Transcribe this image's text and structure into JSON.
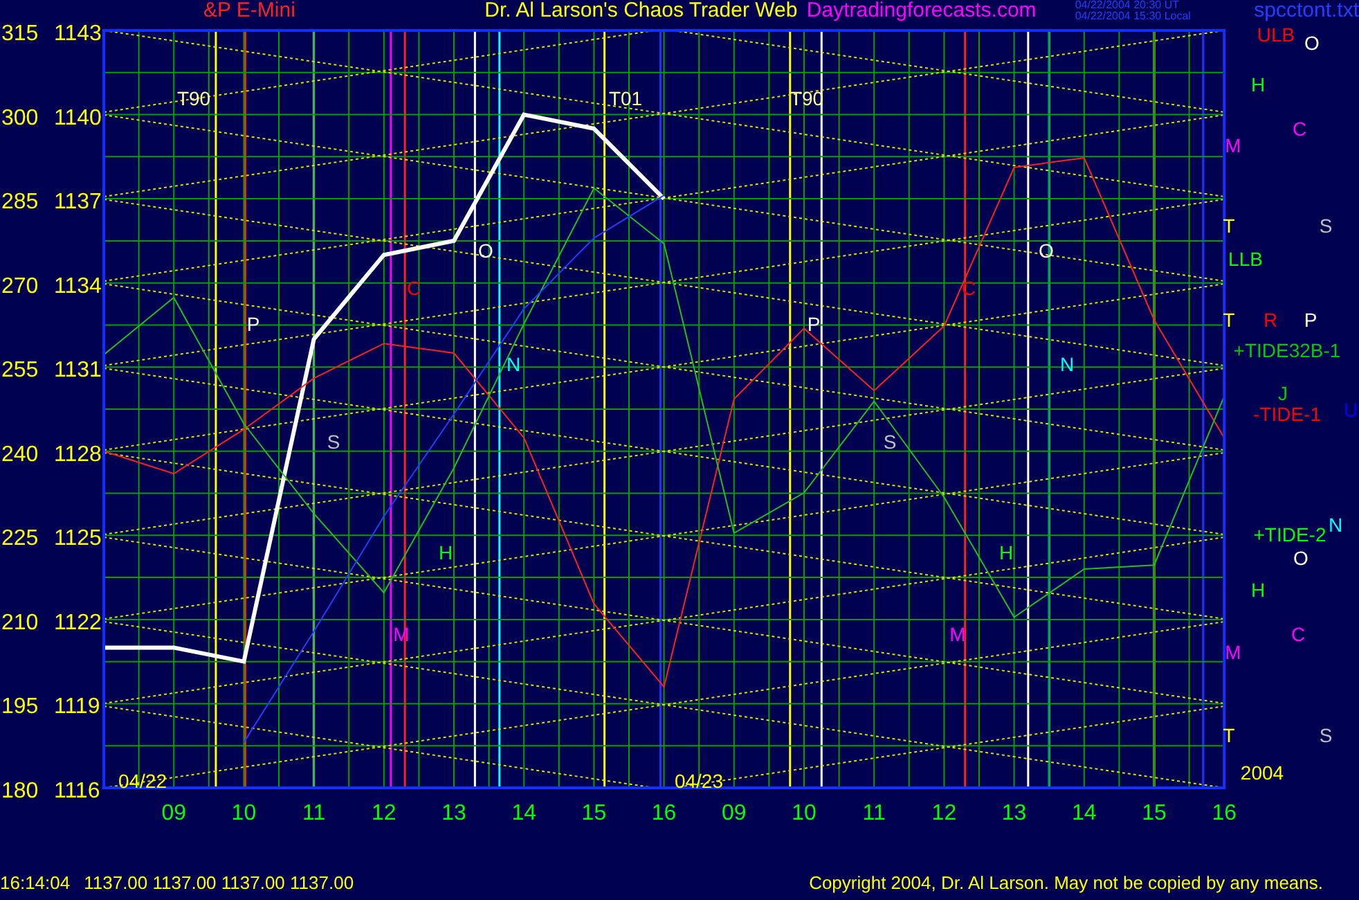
{
  "header": {
    "instrument": "&P E-Mini",
    "title": "Dr. Al Larson's Chaos Trader Web",
    "site": "Daytradingforecasts.com",
    "times": [
      "04/22/2004 20:30 UT",
      "04/22/2004 15:30 Local"
    ],
    "file": "spcctont.txt"
  },
  "chart_data": {
    "type": "line",
    "categories": [
      null,
      "09",
      "10",
      "11",
      "12",
      "13",
      "14",
      "15",
      "16",
      "09",
      "10",
      "11",
      "12",
      "13",
      "14",
      "15",
      "16"
    ],
    "ylim": [
      180,
      315
    ],
    "grid": true,
    "yticks": [
      315,
      300,
      285,
      270,
      255,
      240,
      225,
      210,
      195,
      180
    ],
    "series": [
      {
        "color": "#ffffff",
        "values": [
          205,
          205,
          202.5,
          260,
          275,
          277.5,
          300,
          297.5,
          285,
          null,
          null,
          null,
          null,
          null,
          null,
          null,
          null
        ]
      },
      {
        "color": "#ff2020",
        "values": [
          240,
          236,
          243.9,
          253,
          259.2,
          257.5,
          242.4,
          212.8,
          198,
          249.3,
          261.9,
          250.8,
          262.3,
          290.6,
          292.3,
          263.4,
          242.4
        ]
      },
      {
        "color": "#20c020",
        "values": [
          257.2,
          267.4,
          244.9,
          228.9,
          214.8,
          237,
          262.7,
          286.9,
          277,
          225.4,
          232.6,
          248.9,
          231.8,
          210.4,
          219,
          219.7,
          249.8
        ]
      },
      {
        "color": "#2040ff",
        "values": [
          null,
          null,
          188.1,
          207.9,
          228.4,
          246.6,
          265.4,
          278,
          285.6,
          null,
          null,
          null,
          null,
          null,
          null,
          null,
          null
        ]
      }
    ]
  },
  "price_scale": [
    "1143",
    "1140",
    "1137",
    "1134",
    "1131",
    "1128",
    "1125",
    "1122",
    "1119",
    "1116"
  ],
  "chart_markers": [
    {
      "text": "T90",
      "color": "#ffff99"
    },
    {
      "text": "T01",
      "color": "#ffff99"
    },
    {
      "text": "T90",
      "color": "#ffff99"
    },
    {
      "text": "P",
      "color": "#ffffff"
    },
    {
      "text": "C",
      "color": "#ff0000"
    },
    {
      "text": "O",
      "color": "#ffffff"
    },
    {
      "text": "N",
      "color": "#00ffff"
    },
    {
      "text": "S",
      "color": "#c0c0c0"
    },
    {
      "text": "H",
      "color": "#00ff00"
    },
    {
      "text": "M",
      "color": "#ff00ff"
    },
    {
      "text": "P",
      "color": "#ffffff"
    },
    {
      "text": "O",
      "color": "#ffffff"
    },
    {
      "text": "C",
      "color": "#ff0000"
    },
    {
      "text": "N",
      "color": "#00ffff"
    },
    {
      "text": "S",
      "color": "#c0c0c0"
    },
    {
      "text": "H",
      "color": "#00ff00"
    },
    {
      "text": "M",
      "color": "#ff00ff"
    },
    {
      "text": "04/22",
      "color": "#ffff00"
    },
    {
      "text": "04/23",
      "color": "#ffff00"
    }
  ],
  "side_labels": [
    {
      "text": "ULB",
      "color": "#ff0000"
    },
    {
      "text": "O",
      "color": "#ffffff"
    },
    {
      "text": "H",
      "color": "#00ff00"
    },
    {
      "text": "C",
      "color": "#ff00ff"
    },
    {
      "text": "M",
      "color": "#ff00ff"
    },
    {
      "text": "T",
      "color": "#ffff00"
    },
    {
      "text": "S",
      "color": "#c0c0c0"
    },
    {
      "text": "LLB",
      "color": "#00ff00"
    },
    {
      "text": "T",
      "color": "#ffff00"
    },
    {
      "text": "R",
      "color": "#ff0000"
    },
    {
      "text": "P",
      "color": "#ffffff"
    },
    {
      "text": "+TIDE32B-1",
      "color": "#00cc00"
    },
    {
      "text": "J",
      "color": "#00cc00"
    },
    {
      "text": "-TIDE-1",
      "color": "#ff0000"
    },
    {
      "text": "U",
      "color": "#0000ff"
    },
    {
      "text": "+TIDE-2",
      "color": "#00ff00"
    },
    {
      "text": "N",
      "color": "#00ffff"
    },
    {
      "text": "O",
      "color": "#ffffff"
    },
    {
      "text": "H",
      "color": "#00ff00"
    },
    {
      "text": "C",
      "color": "#ff00ff"
    },
    {
      "text": "M",
      "color": "#ff00ff"
    },
    {
      "text": "T",
      "color": "#ffff00"
    },
    {
      "text": "S",
      "color": "#c0c0c0"
    },
    {
      "text": "2004",
      "color": "#ffff00"
    }
  ],
  "status_bar": {
    "time": "16:14:04",
    "quotes": "1137.00 1137.00 1137.00 1137.00",
    "copyright": "Copyright 2004, Dr. Al Larson. May not be copied by any means."
  }
}
